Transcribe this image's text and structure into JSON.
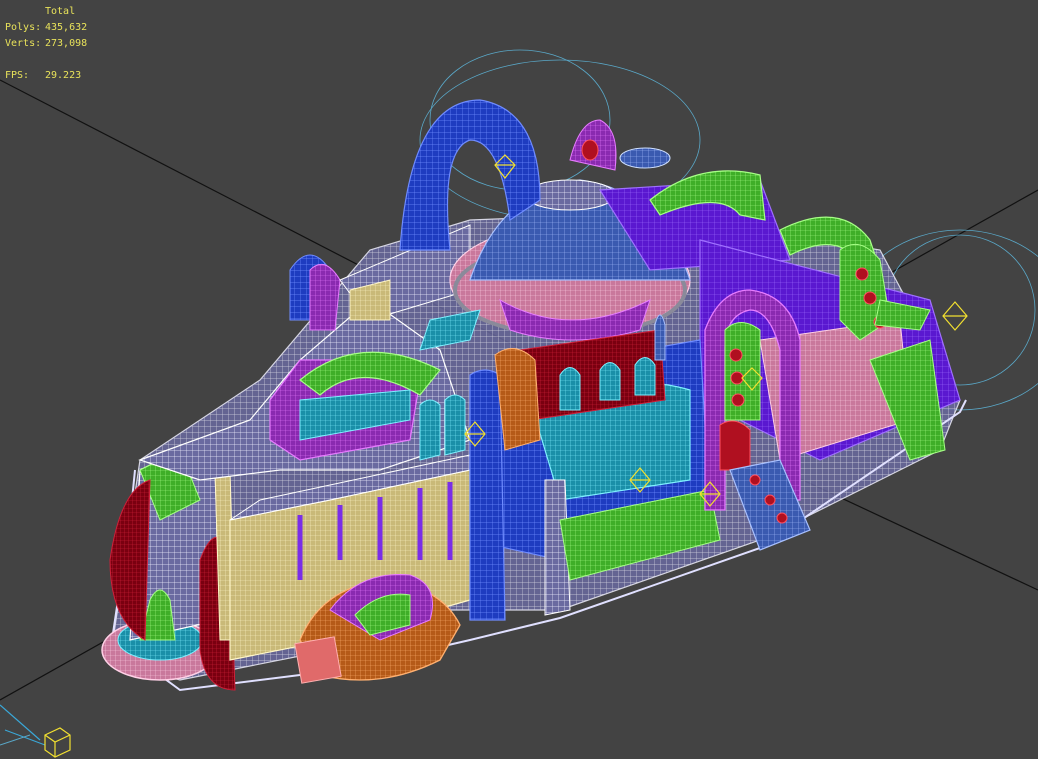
{
  "viewport": {
    "background": "#434343",
    "stats": {
      "title": "Total",
      "polys_label": "Polys:",
      "polys_value": "435,632",
      "verts_label": "Verts:",
      "verts_value": "273,098",
      "fps_label": "FPS:",
      "fps_value": "29.223",
      "color": "#e8e25a"
    },
    "model": {
      "icons": [
        "light-helper-icon",
        "view-cube-icon",
        "axis-gizmo-icon"
      ],
      "wire_colors": {
        "blue": "#2a52e6",
        "cyan": "#2ec9d8",
        "magenta": "#c23ae0",
        "purple": "#7a2ee8",
        "green": "#5ad63a",
        "yellow": "#f2e6a0",
        "pink": "#f0a8c8",
        "red": "#b01020",
        "orange": "#e07a2a",
        "white": "#e8e8ff",
        "lightblue": "#6a8adf"
      }
    }
  }
}
